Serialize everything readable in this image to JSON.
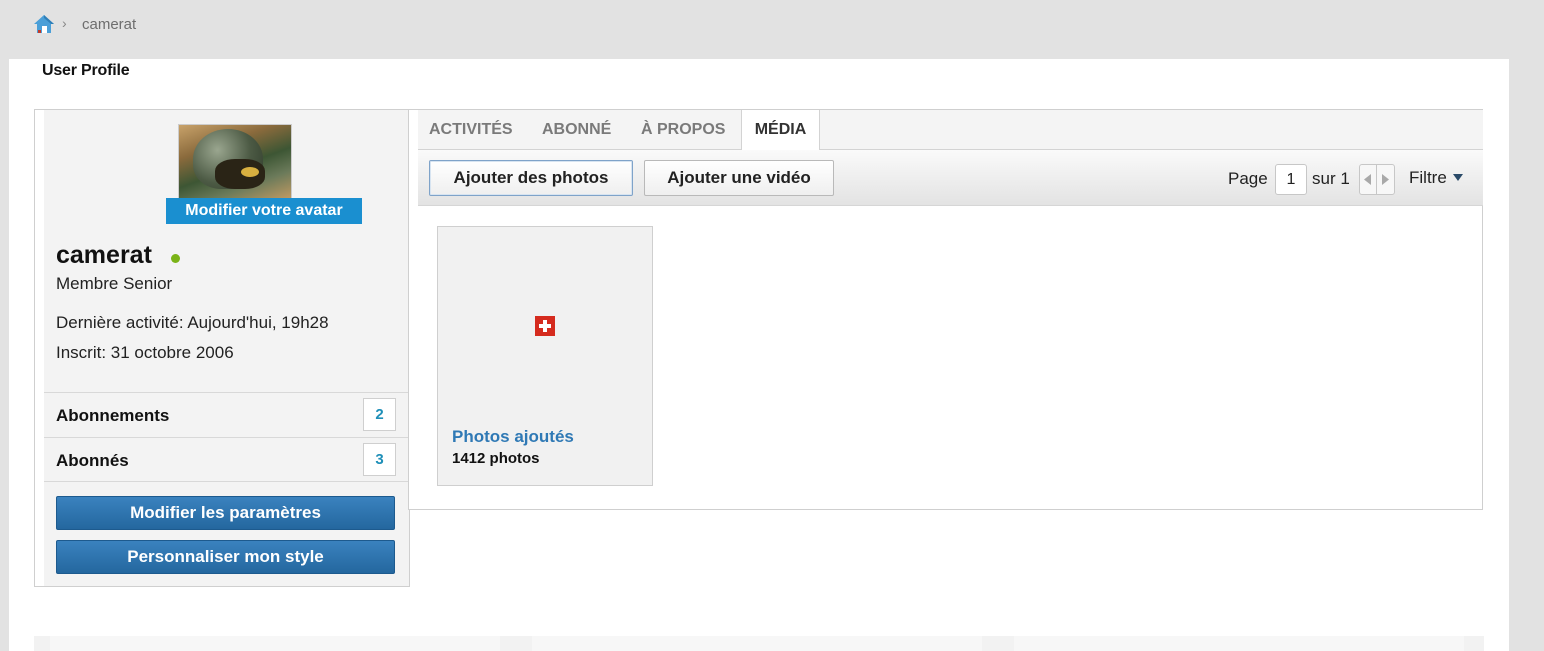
{
  "breadcrumb": {
    "separator": "›",
    "current": "camerat"
  },
  "page": {
    "title": "User Profile"
  },
  "profile": {
    "avatar_button": "Modifier votre avatar",
    "username": "camerat",
    "rank": "Membre Senior",
    "last_activity": "Dernière activité: Aujourd'hui, 19h28",
    "joined": "Inscrit: 31 octobre 2006",
    "stats": [
      {
        "label": "Abonnements",
        "count": "2"
      },
      {
        "label": "Abonnés",
        "count": "3"
      }
    ],
    "buttons": {
      "settings": "Modifier les paramètres",
      "style": "Personnaliser mon style"
    }
  },
  "tabs": [
    {
      "label": "ACTIVITÉS"
    },
    {
      "label": "ABONNÉ"
    },
    {
      "label": "À PROPOS"
    },
    {
      "label": "MÉDIA",
      "active": true
    }
  ],
  "toolbar": {
    "add_photos": "Ajouter des photos",
    "add_video": "Ajouter une vidéo",
    "page_label": "Page",
    "page_value": "1",
    "of_label": "sur 1",
    "filter_label": "Filtre"
  },
  "albums": [
    {
      "title": "Photos ajoutés",
      "count": "1412 photos",
      "icon": "swiss-flag-icon"
    }
  ],
  "colors": {
    "accent_blue": "#1a8fd0",
    "button_blue": "#24679f",
    "link_blue": "#2f79b5",
    "online_green": "#7ab317",
    "count_blue": "#1f8fb8"
  }
}
